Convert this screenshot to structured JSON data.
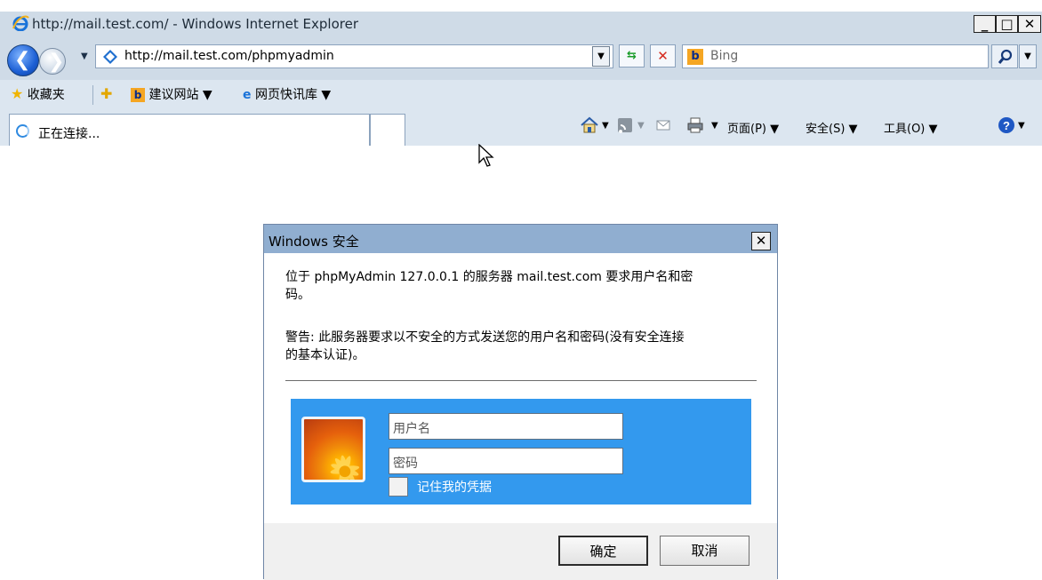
{
  "window": {
    "title": "http://mail.test.com/ - Windows Internet Explorer",
    "minimize": "_",
    "maximize": "□",
    "close": "✕"
  },
  "navbar": {
    "address": "http://mail.test.com/phpmyadmin",
    "search_placeholder": "Bing",
    "refresh_icon": "refresh-icon",
    "stop_icon": "stop-icon"
  },
  "favorites": {
    "label": "收藏夹",
    "suggested_sites": "建议网站 ▼",
    "web_slice": "网页快讯库 ▼"
  },
  "tab": {
    "label": "正在连接..."
  },
  "commands": {
    "page": "页面(P) ▼",
    "safety": "安全(S) ▼",
    "tools": "工具(O) ▼"
  },
  "dialog": {
    "title": "Windows 安全",
    "message_line1": "位于 phpMyAdmin 127.0.0.1 的服务器 mail.test.com 要求用户名和密",
    "message_line2": "码。",
    "warning_line1": "警告: 此服务器要求以不安全的方式发送您的用户名和密码(没有安全连接",
    "warning_line2": "的基本认证)。",
    "username_placeholder": "用户名",
    "password_placeholder": "密码",
    "remember_label": "记住我的凭据",
    "ok_label": "确定",
    "cancel_label": "取消",
    "close_label": "✕"
  },
  "colors": {
    "chrome": "#cfdbe7",
    "dialog_title": "#90aed0",
    "credential_panel": "#3399ee"
  }
}
